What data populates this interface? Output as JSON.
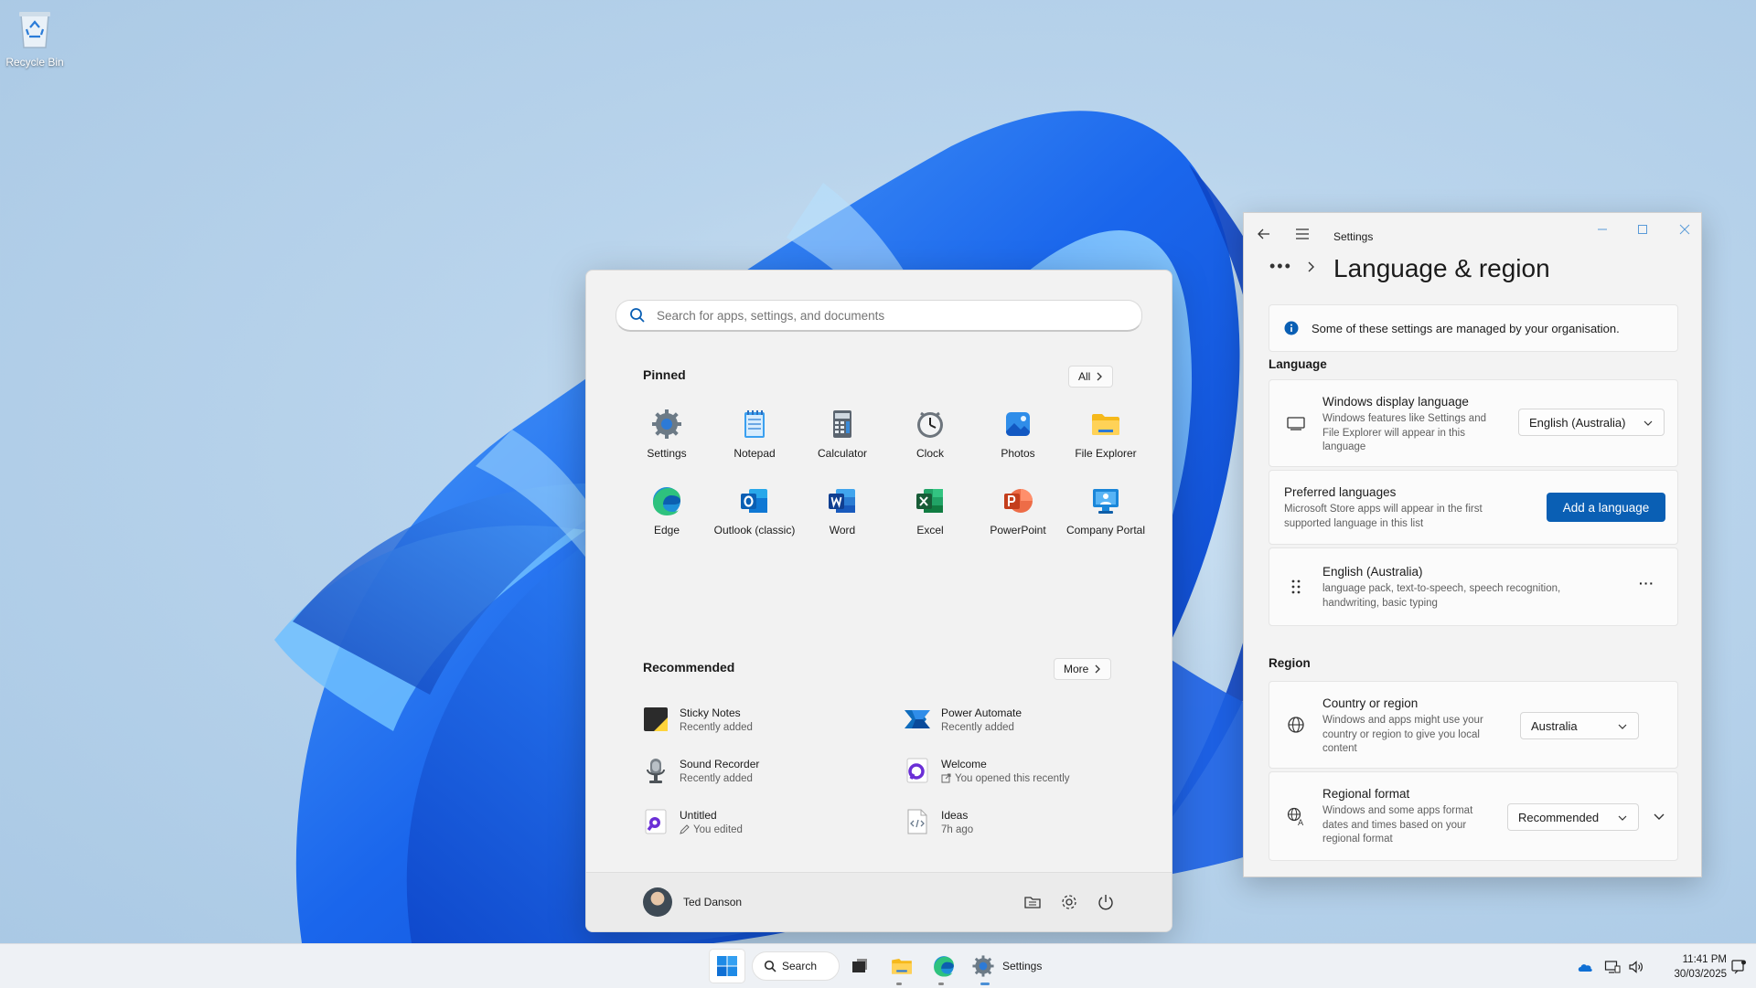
{
  "desktop": {
    "recycle_bin_label": "Recycle Bin"
  },
  "start_menu": {
    "search_placeholder": "Search for apps, settings, and documents",
    "pinned_title": "Pinned",
    "all_button": "All",
    "pinned_apps": [
      {
        "label": "Settings",
        "icon": "settings-gear-icon"
      },
      {
        "label": "Notepad",
        "icon": "notepad-icon"
      },
      {
        "label": "Calculator",
        "icon": "calculator-icon"
      },
      {
        "label": "Clock",
        "icon": "clock-icon"
      },
      {
        "label": "Photos",
        "icon": "photos-icon"
      },
      {
        "label": "File Explorer",
        "icon": "folder-icon"
      },
      {
        "label": "Edge",
        "icon": "edge-icon"
      },
      {
        "label": "Outlook (classic)",
        "icon": "outlook-icon"
      },
      {
        "label": "Word",
        "icon": "word-icon"
      },
      {
        "label": "Excel",
        "icon": "excel-icon"
      },
      {
        "label": "PowerPoint",
        "icon": "powerpoint-icon"
      },
      {
        "label": "Company Portal",
        "icon": "company-portal-icon"
      }
    ],
    "recommended_title": "Recommended",
    "more_button": "More",
    "recommended": [
      {
        "title": "Sticky Notes",
        "subtitle": "Recently added",
        "icon": "sticky-notes-icon"
      },
      {
        "title": "Power Automate",
        "subtitle": "Recently added",
        "icon": "power-automate-icon"
      },
      {
        "title": "Sound Recorder",
        "subtitle": "Recently added",
        "icon": "sound-recorder-icon"
      },
      {
        "title": "Welcome",
        "subtitle": "You opened this recently",
        "icon": "welcome-icon"
      },
      {
        "title": "Untitled",
        "subtitle": "You edited",
        "icon": "loop-icon"
      },
      {
        "title": "Ideas",
        "subtitle": "7h ago",
        "icon": "code-file-icon"
      }
    ],
    "user_name": "Ted Danson"
  },
  "settings": {
    "window_title": "Settings",
    "page_title": "Language & region",
    "info_message": "Some of these settings are managed by your organisation.",
    "language_section": "Language",
    "display_language": {
      "title": "Windows display language",
      "desc_lines": [
        "Windows features like Settings and",
        "File Explorer will appear in this",
        "language"
      ],
      "value": "English (Australia)"
    },
    "preferred_languages": {
      "title": "Preferred languages",
      "desc_lines": [
        "Microsoft Store apps will appear in the first",
        "supported language in this list"
      ],
      "button": "Add a language"
    },
    "installed_language": {
      "title": "English (Australia)",
      "desc_lines": [
        "language pack, text-to-speech, speech recognition,",
        "handwriting, basic typing"
      ],
      "more": "···"
    },
    "region_section": "Region",
    "country": {
      "title": "Country or region",
      "desc_lines": [
        "Windows and apps might use your",
        "country or region to give you local",
        "content"
      ],
      "value": "Australia"
    },
    "regional_format": {
      "title": "Regional format",
      "desc_lines": [
        "Windows and some apps format",
        "dates and times based on your",
        "regional format"
      ],
      "value": "Recommended"
    }
  },
  "taskbar": {
    "search_label": "Search",
    "settings_label": "Settings",
    "time": "11:41 PM",
    "date": "30/03/2025"
  },
  "colors": {
    "accent": "#0a5fb4",
    "wallpaper_blue": "#1f6ff0"
  }
}
